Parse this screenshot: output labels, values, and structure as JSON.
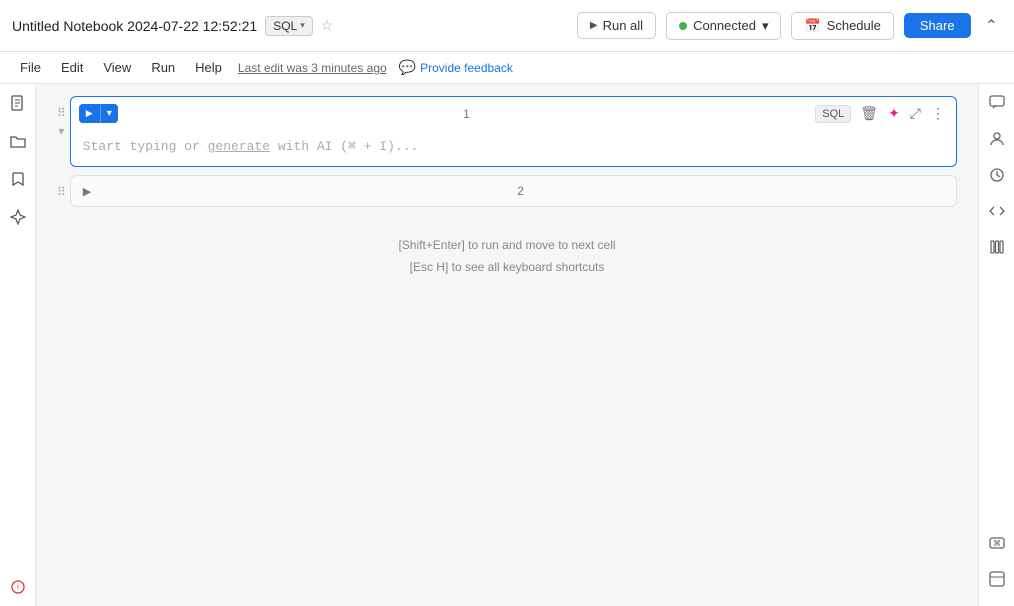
{
  "title": {
    "notebook_name": "Untitled Notebook 2024-07-22 12:52:21",
    "sql_badge": "SQL",
    "chevron": "▾",
    "star": "☆",
    "last_edit": "Last edit was 3 minutes ago",
    "feedback": "Provide feedback"
  },
  "menu": {
    "items": [
      "File",
      "Edit",
      "View",
      "Run",
      "Help"
    ]
  },
  "toolbar": {
    "run_all": "Run all",
    "connected": "Connected",
    "schedule": "Schedule",
    "share": "Share",
    "collapse": "⌃"
  },
  "cells": [
    {
      "number": "1",
      "type": "SQL",
      "placeholder": "Start typing or generate with AI (⌘ + I)..."
    },
    {
      "number": "2"
    }
  ],
  "hints": [
    "[Shift+Enter] to run and move to next cell",
    "[Esc H] to see all keyboard shortcuts"
  ],
  "left_sidebar": {
    "icons": [
      "📄",
      "📁",
      "🔖",
      "✨"
    ]
  },
  "right_sidebar": {
    "icons": [
      "💬",
      "👤",
      "🕐",
      "</>",
      "📚"
    ],
    "bottom_icons": [
      "⌘",
      "⬜"
    ]
  }
}
